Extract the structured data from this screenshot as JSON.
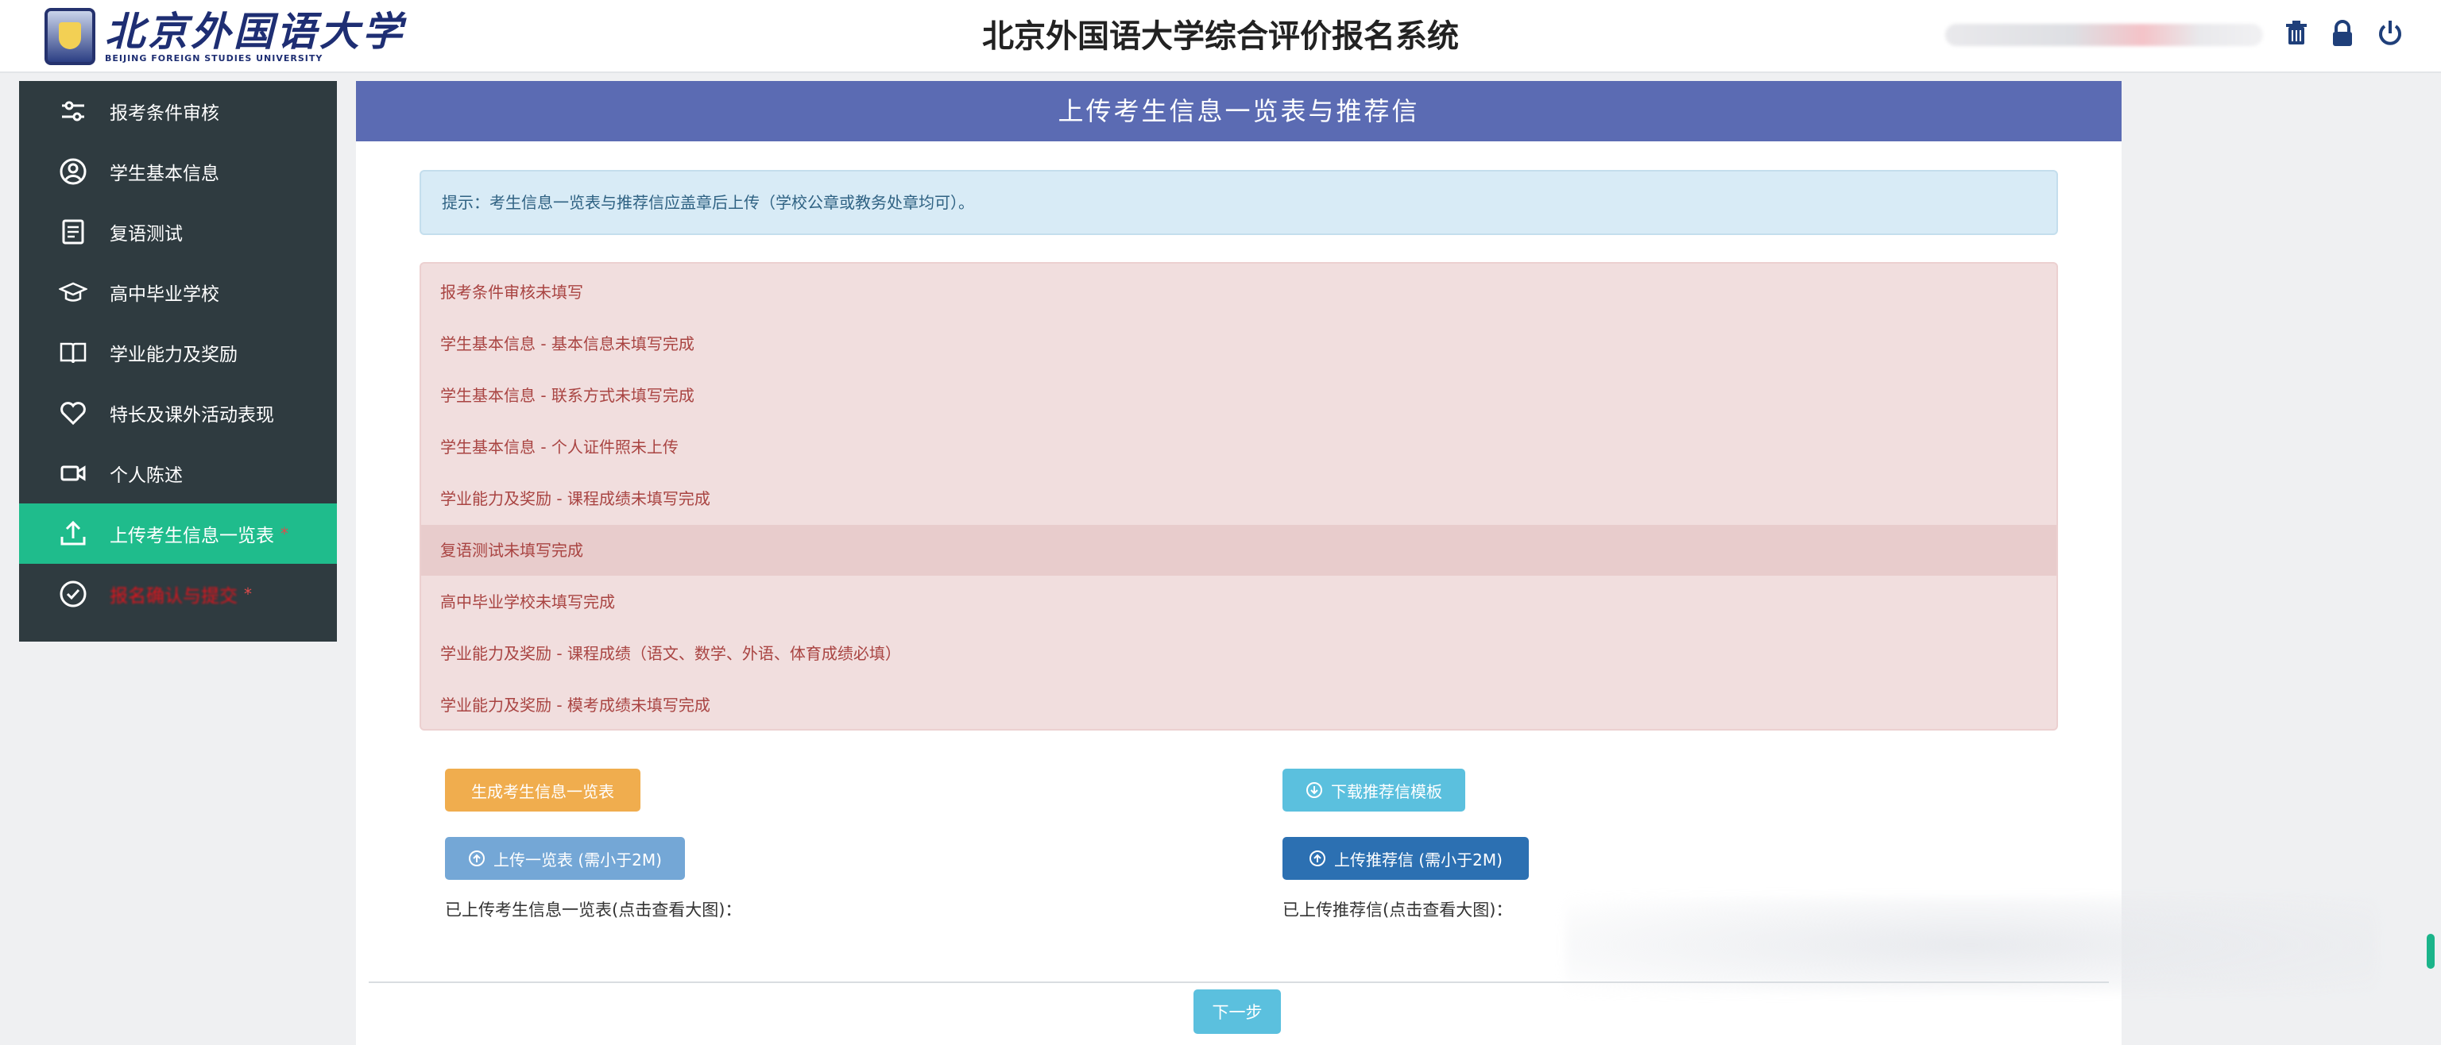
{
  "header": {
    "logo_cn": "北京外国语大学",
    "logo_en": "BEIJING FOREIGN STUDIES UNIVERSITY",
    "title": "北京外国语大学综合评价报名系统"
  },
  "sidebar": {
    "items": [
      {
        "label": "报考条件审核",
        "icon": "sliders-icon"
      },
      {
        "label": "学生基本信息",
        "icon": "user-circle-icon"
      },
      {
        "label": "复语测试",
        "icon": "notepad-icon"
      },
      {
        "label": "高中毕业学校",
        "icon": "graduation-cap-icon"
      },
      {
        "label": "学业能力及奖励",
        "icon": "book-icon"
      },
      {
        "label": "特长及课外活动表现",
        "icon": "heart-icon"
      },
      {
        "label": "个人陈述",
        "icon": "video-camera-icon"
      },
      {
        "label": "上传考生信息一览表",
        "icon": "upload-icon",
        "dot": "*"
      },
      {
        "label": "报名确认与提交",
        "icon": "check-circle-icon",
        "dot": "*"
      }
    ]
  },
  "panel": {
    "title": "上传考生信息一览表与推荐信",
    "tip": "提示：考生信息一览表与推荐信应盖章后上传（学校公章或教务处章均可）。",
    "errors": [
      "报考条件审核未填写",
      "学生基本信息 - 基本信息未填写完成",
      "学生基本信息 - 联系方式未填写完成",
      "学生基本信息 - 个人证件照未上传",
      "学业能力及奖励 - 课程成绩未填写完成",
      "复语测试未填写完成",
      "高中毕业学校未填写完成",
      "学业能力及奖励 - 课程成绩（语文、数学、外语、体育成绩必填）",
      "学业能力及奖励 - 模考成绩未填写完成"
    ],
    "buttons": {
      "generate": "生成考生信息一览表",
      "template": "下载推荐信模板",
      "upload_list": "上传一览表 (需小于2M)",
      "upload_letter": "上传推荐信 (需小于2M)",
      "next": "下一步"
    },
    "uploaded_list_label": "已上传考生信息一览表(点击查看大图)：",
    "uploaded_letter_label": "已上传推荐信(点击查看大图)："
  },
  "colors": {
    "header_bar": "#5b6bb3",
    "sidebar_bg": "#2f3b40",
    "active": "#1fbc8c",
    "error_bg": "#f1dede",
    "error_text": "#a94442"
  }
}
